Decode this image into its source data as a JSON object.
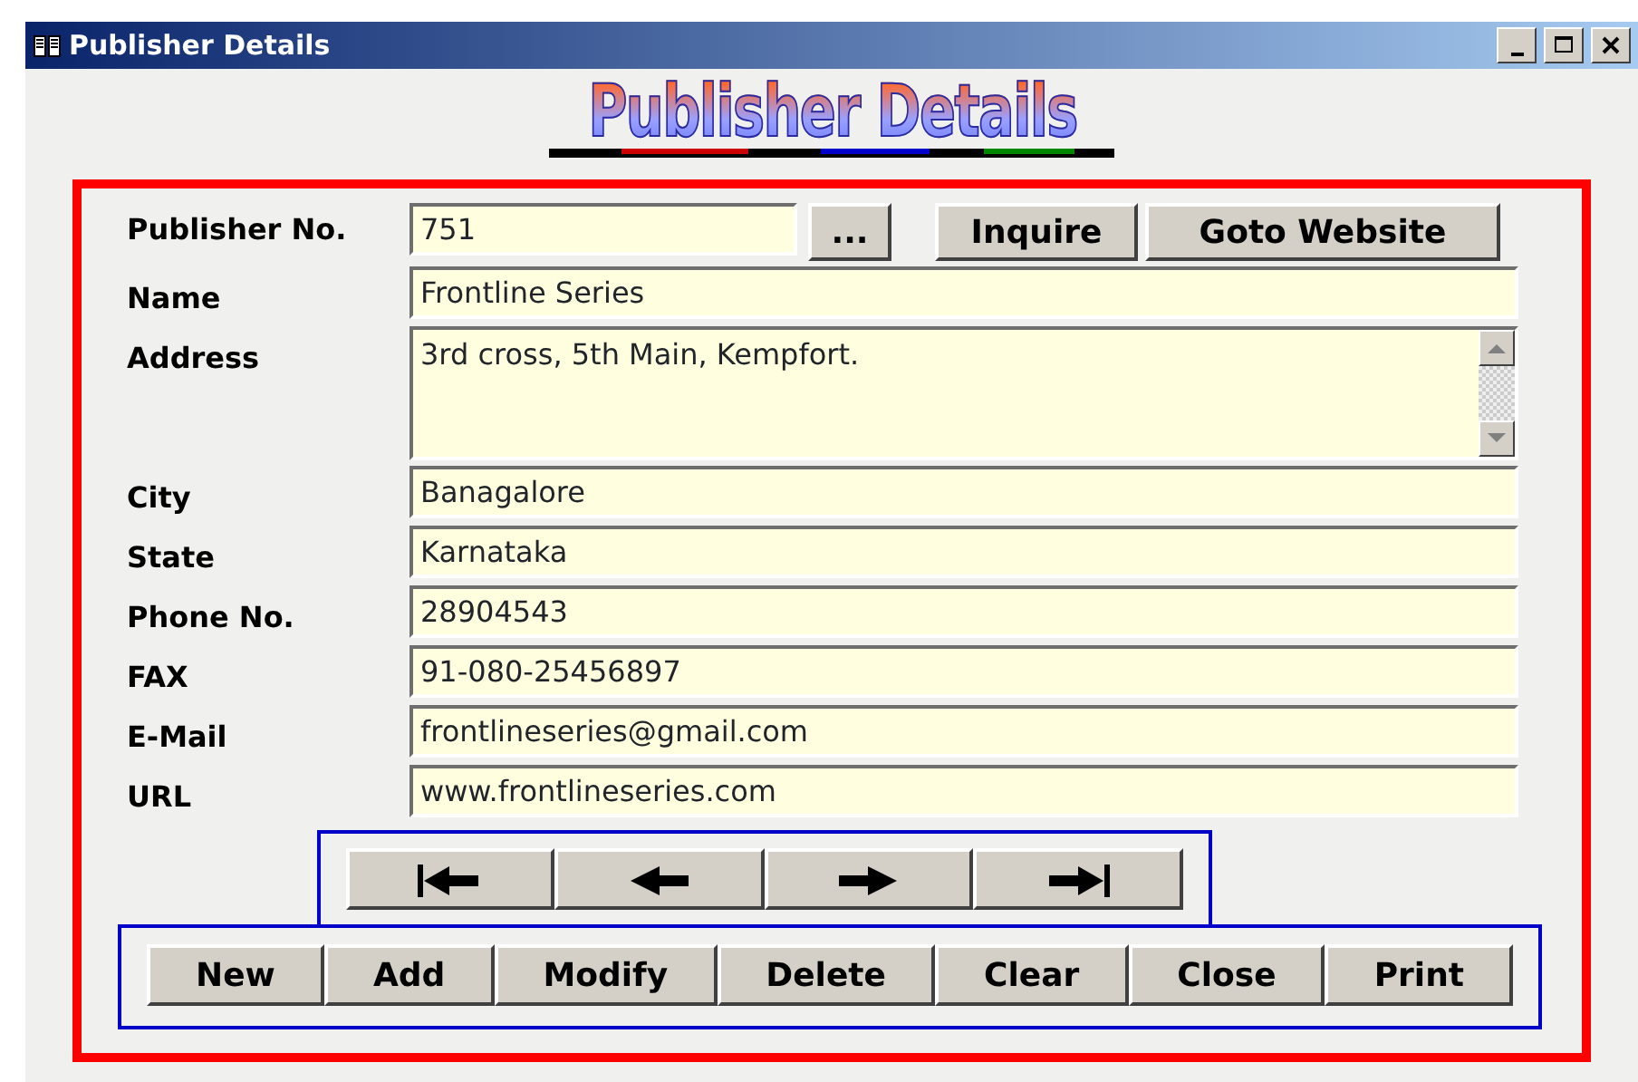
{
  "window": {
    "title": "Publisher Details",
    "controls": [
      {
        "kind": "minimize"
      },
      {
        "kind": "maximize"
      },
      {
        "kind": "close"
      }
    ]
  },
  "heading": "Publisher Details",
  "fields": [
    {
      "label": "Publisher No.",
      "value": "751",
      "kind": "lookup"
    },
    {
      "label": "Name",
      "value": "Frontline Series",
      "kind": "text"
    },
    {
      "label": "Address",
      "value": "3rd cross, 5th Main, Kempfort.",
      "kind": "memo"
    },
    {
      "label": "City",
      "value": "Banagalore",
      "kind": "text"
    },
    {
      "label": "State",
      "value": "Karnataka",
      "kind": "text"
    },
    {
      "label": "Phone No.",
      "value": "28904543",
      "kind": "text"
    },
    {
      "label": "FAX",
      "value": "91-080-25456897",
      "kind": "text"
    },
    {
      "label": "E-Mail",
      "value": "frontlineseries@gmail.com",
      "kind": "text"
    },
    {
      "label": "URL",
      "value": "www.frontlineseries.com",
      "kind": "text"
    }
  ],
  "lookup_buttons": [
    {
      "label": "..."
    },
    {
      "label": "Inquire"
    },
    {
      "label": "Goto Website"
    }
  ],
  "navigation": [
    {
      "kind": "first"
    },
    {
      "kind": "previous"
    },
    {
      "kind": "next"
    },
    {
      "kind": "last"
    }
  ],
  "actions": [
    {
      "label": "New"
    },
    {
      "label": "Add"
    },
    {
      "label": "Modify"
    },
    {
      "label": "Delete"
    },
    {
      "label": "Clear"
    },
    {
      "label": "Close"
    },
    {
      "label": "Print"
    }
  ]
}
